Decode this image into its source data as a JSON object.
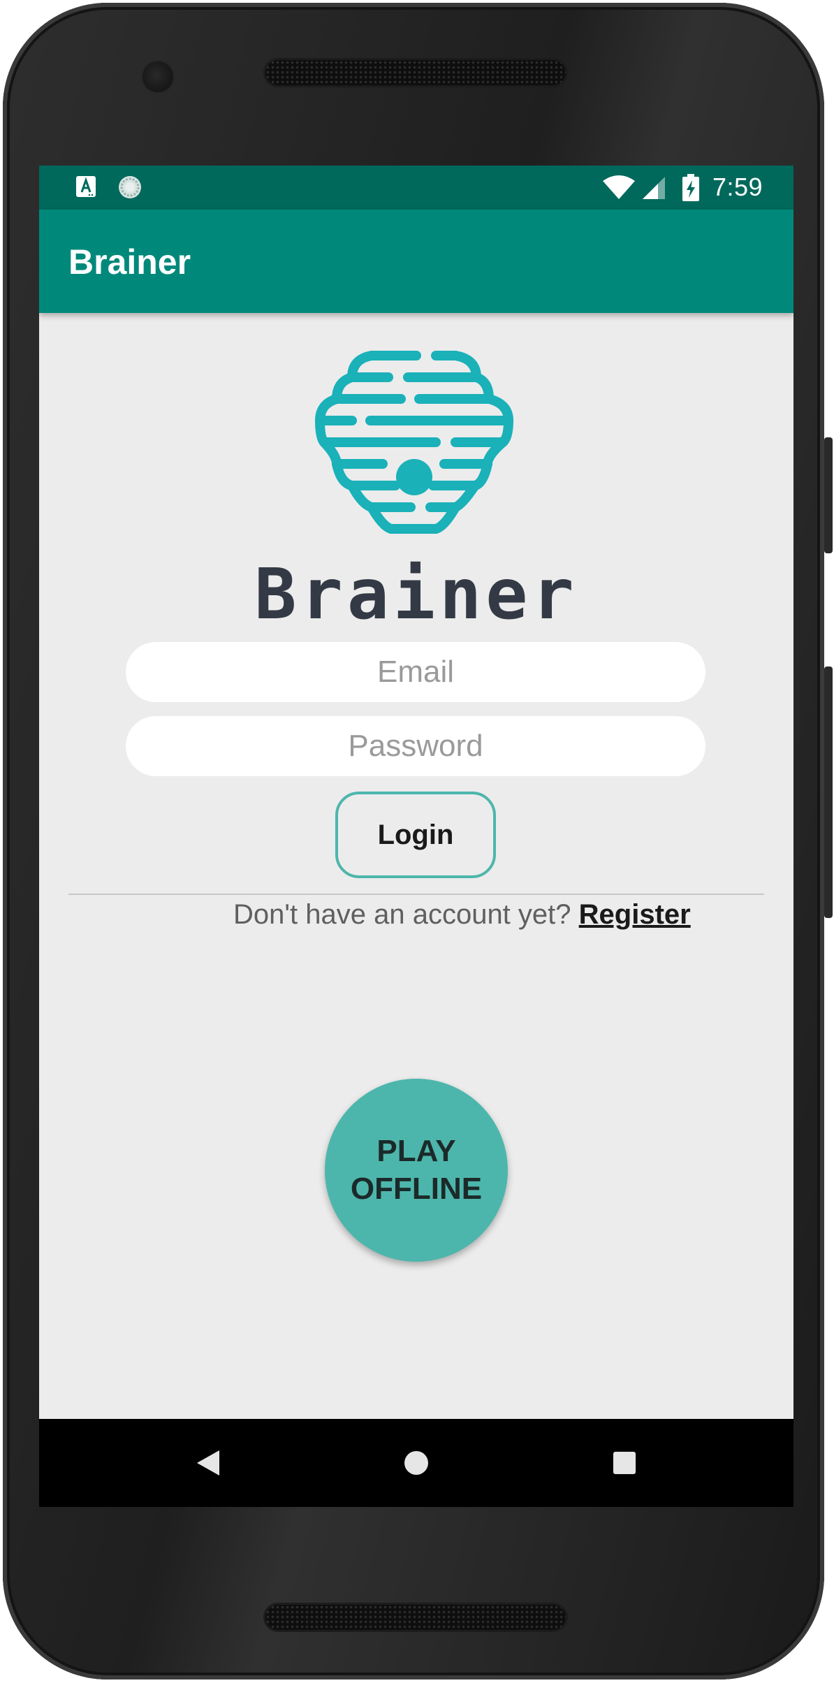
{
  "status_bar": {
    "time": "7:59",
    "icons": [
      "a-notification-icon",
      "sync-icon",
      "wifi-icon",
      "cell-signal-icon",
      "battery-charging-icon"
    ]
  },
  "app_bar": {
    "title": "Brainer"
  },
  "logo": {
    "icon": "brain-hive-logo-icon",
    "text": "Brainer"
  },
  "login_form": {
    "email_placeholder": "Email",
    "email_value": "",
    "password_placeholder": "Password",
    "password_value": "",
    "login_label": "Login"
  },
  "register_prompt": {
    "text": "Don't have an account yet? ",
    "link_label": "Register"
  },
  "offline_button": {
    "line1": "PLAY",
    "line2": "OFFLINE"
  },
  "nav_bar": {
    "icons": [
      "back-icon",
      "home-icon",
      "recents-icon"
    ]
  },
  "colors": {
    "status_bar": "#00695c",
    "app_bar": "#00897b",
    "accent": "#4db6ac",
    "logo": "#1ab1b9",
    "background": "#ececec"
  }
}
